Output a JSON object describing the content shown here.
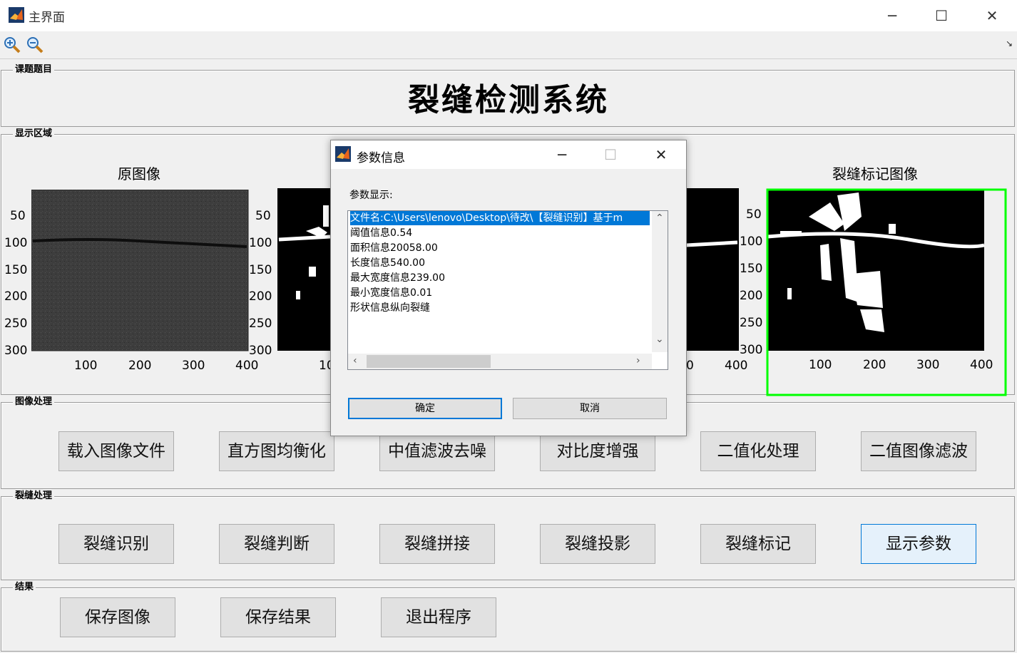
{
  "window": {
    "title": "主界面"
  },
  "panels": {
    "title_section": "课题题目",
    "display": "显示区域",
    "image_processing": "图像处理",
    "crack_processing": "裂缝处理",
    "results": "结果"
  },
  "main_title": "裂缝检测系统",
  "plots": {
    "original_title": "原图像",
    "marked_title": "裂缝标记图像",
    "y_ticks": [
      "50",
      "100",
      "150",
      "200",
      "250",
      "300"
    ],
    "x_ticks": [
      "100",
      "200",
      "300",
      "400"
    ],
    "partial_x_first": "10",
    "partial_x_mid": "0",
    "partial_x_last": "400"
  },
  "buttons": {
    "image_processing": [
      "载入图像文件",
      "直方图均衡化",
      "中值滤波去噪",
      "对比度增强",
      "二值化处理",
      "二值图像滤波"
    ],
    "crack_processing": [
      "裂缝识别",
      "裂缝判断",
      "裂缝拼接",
      "裂缝投影",
      "裂缝标记",
      "显示参数"
    ],
    "results": [
      "保存图像",
      "保存结果",
      "退出程序"
    ]
  },
  "dialog": {
    "title": "参数信息",
    "label": "参数显示:",
    "list": [
      "文件名:C:\\Users\\lenovo\\Desktop\\待改\\【裂缝识别】基于m",
      "阈值信息0.54",
      "面积信息20058.00",
      "长度信息540.00",
      "最大宽度信息239.00",
      "最小宽度信息0.01",
      "形状信息纵向裂缝"
    ],
    "ok": "确定",
    "cancel": "取消"
  },
  "colors": {
    "selection": "#0078d7",
    "marker_box": "#00ff00",
    "button_active_border": "#0078d7"
  },
  "icons": [
    "matlab-icon",
    "zoom-in-icon",
    "zoom-out-icon",
    "minimize-icon",
    "maximize-icon",
    "close-icon"
  ]
}
